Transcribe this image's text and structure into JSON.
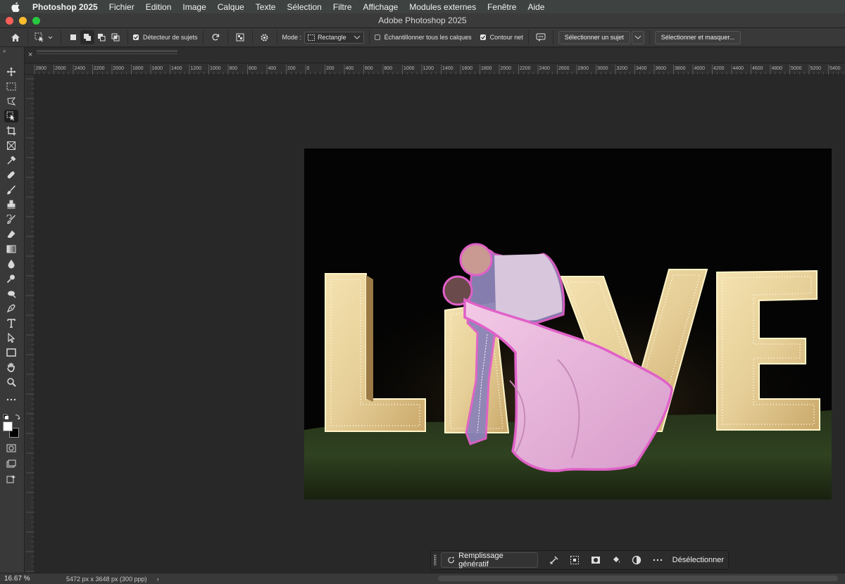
{
  "menubar": {
    "app_name": "Photoshop 2025",
    "items": [
      "Fichier",
      "Edition",
      "Image",
      "Calque",
      "Texte",
      "Sélection",
      "Filtre",
      "Affichage",
      "Modules externes",
      "Fenêtre",
      "Aide"
    ]
  },
  "window": {
    "title": "Adobe Photoshop 2025",
    "traffic_lights": [
      "#ff5f57",
      "#febc2e",
      "#28c840"
    ]
  },
  "options_bar": {
    "subject_detector_label": "Détecteur de sujets",
    "subject_detector_checked": true,
    "mode_label": "Mode :",
    "mode_value": "Rectangle",
    "sample_all_layers_label": "Échantillonner tous les calques",
    "sample_all_layers_checked": false,
    "hard_edge_label": "Contour net",
    "hard_edge_checked": true,
    "select_subject_label": "Sélectionner un sujet",
    "select_and_mask_label": "Sélectionner et masquer..."
  },
  "ruler": {
    "top_ticks": [
      "2800",
      "2600",
      "2400",
      "2200",
      "2000",
      "1800",
      "1600",
      "1400",
      "1200",
      "1000",
      "800",
      "600",
      "400",
      "200",
      "0",
      "200",
      "400",
      "600",
      "800",
      "1000",
      "1200",
      "1400",
      "1600",
      "1800",
      "2000",
      "2200",
      "2400",
      "2600",
      "2800",
      "3000",
      "3200",
      "3400",
      "3600",
      "3800",
      "4000",
      "4200",
      "4400",
      "4600",
      "4800",
      "5000",
      "5200",
      "5400"
    ]
  },
  "tools": [
    "move-tool",
    "marquee-tool",
    "lasso-tool",
    "object-selection-tool",
    "crop-tool",
    "frame-tool",
    "eyedropper-tool",
    "healing-brush-tool",
    "brush-tool",
    "clone-stamp-tool",
    "history-brush-tool",
    "eraser-tool",
    "gradient-tool",
    "blur-tool",
    "dodge-tool",
    "smudge-tool",
    "pen-tool",
    "type-tool",
    "path-selection-tool",
    "rectangle-tool",
    "hand-tool",
    "zoom-tool",
    "more-tools"
  ],
  "colors": {
    "accent_selection": "#e060c8",
    "foreground": "#ffffff",
    "background": "#000000"
  },
  "photo": {
    "letters": [
      "L",
      "V",
      "E"
    ]
  },
  "taskbar": {
    "generative_fill_label": "Remplissage génératif",
    "deselect_label": "Désélectionner"
  },
  "statusbar": {
    "zoom": "16.67 %",
    "dimensions": "5472 px x 3648 px (300 ppp)",
    "chevron": "›"
  }
}
